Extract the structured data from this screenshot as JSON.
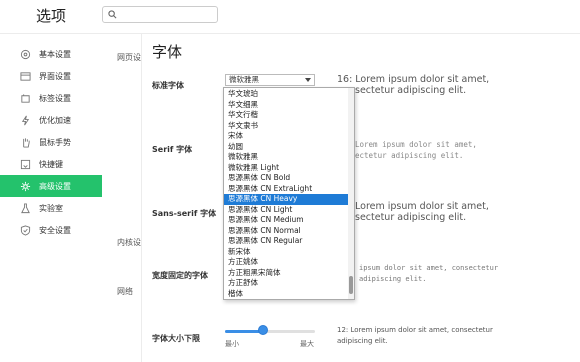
{
  "app": {
    "title": "选项"
  },
  "search": {
    "value": "",
    "placeholder": ""
  },
  "sidebar": {
    "items": [
      {
        "label": "基本设置",
        "icon": "gear-icon"
      },
      {
        "label": "界面设置",
        "icon": "window-icon"
      },
      {
        "label": "标签设置",
        "icon": "tab-icon"
      },
      {
        "label": "优化加速",
        "icon": "lightning-icon"
      },
      {
        "label": "鼠标手势",
        "icon": "hand-icon"
      },
      {
        "label": "快捷键",
        "icon": "keyboard-icon"
      },
      {
        "label": "高级设置",
        "icon": "advanced-icon",
        "active": true
      },
      {
        "label": "实验室",
        "icon": "flask-icon"
      },
      {
        "label": "安全设置",
        "icon": "shield-icon"
      }
    ]
  },
  "subnav": {
    "items": [
      "网页设",
      "内核设",
      "网络"
    ]
  },
  "fonts": {
    "title": "字体",
    "standard": {
      "label": "标准字体",
      "selected": "微软雅黑",
      "preview": "16: Lorem ipsum dolor sit amet, consectetur adipiscing elit.",
      "preview_visible": [
        "16: Lorem ipsum dolor sit amet,",
        "sectetur adipiscing elit."
      ]
    },
    "serif": {
      "label": "Serif 字体",
      "preview_visible": [
        "Lorem ipsum dolor sit amet,",
        "ectetur adipiscing elit."
      ]
    },
    "sans": {
      "label": "Sans-serif 字体",
      "preview_visible": [
        "Lorem ipsum dolor sit amet,",
        "sectetur adipiscing elit."
      ]
    },
    "fixed": {
      "label": "宽度固定的字体",
      "preview_visible": [
        "ipsum dolor sit amet, consectetur",
        "adipiscing elit."
      ]
    },
    "size": {
      "label": "字体大小下限",
      "min_label": "最小",
      "max_label": "最大",
      "level": 0.42,
      "preview_visible": [
        "12: Lorem ipsum dolor sit amet, consectetur",
        "adipiscing elit."
      ]
    }
  },
  "dropdown": {
    "options": [
      "华文琥珀",
      "华文细黑",
      "华文行楷",
      "华文隶书",
      "宋体",
      "幼圆",
      "微软雅黑",
      "微软雅黑 Light",
      "思源黑体 CN Bold",
      "思源黑体 CN ExtraLight",
      "思源黑体 CN Heavy",
      "思源黑体 CN Light",
      "思源黑体 CN Medium",
      "思源黑体 CN Normal",
      "思源黑体 CN Regular",
      "新宋体",
      "方正姚体",
      "方正粗黑宋简体",
      "方正舒体",
      "楷体"
    ],
    "selected_index": 10
  },
  "colors": {
    "accent": "#24c26c",
    "selection": "#1e7bd6",
    "slider": "#3a8ee6"
  }
}
